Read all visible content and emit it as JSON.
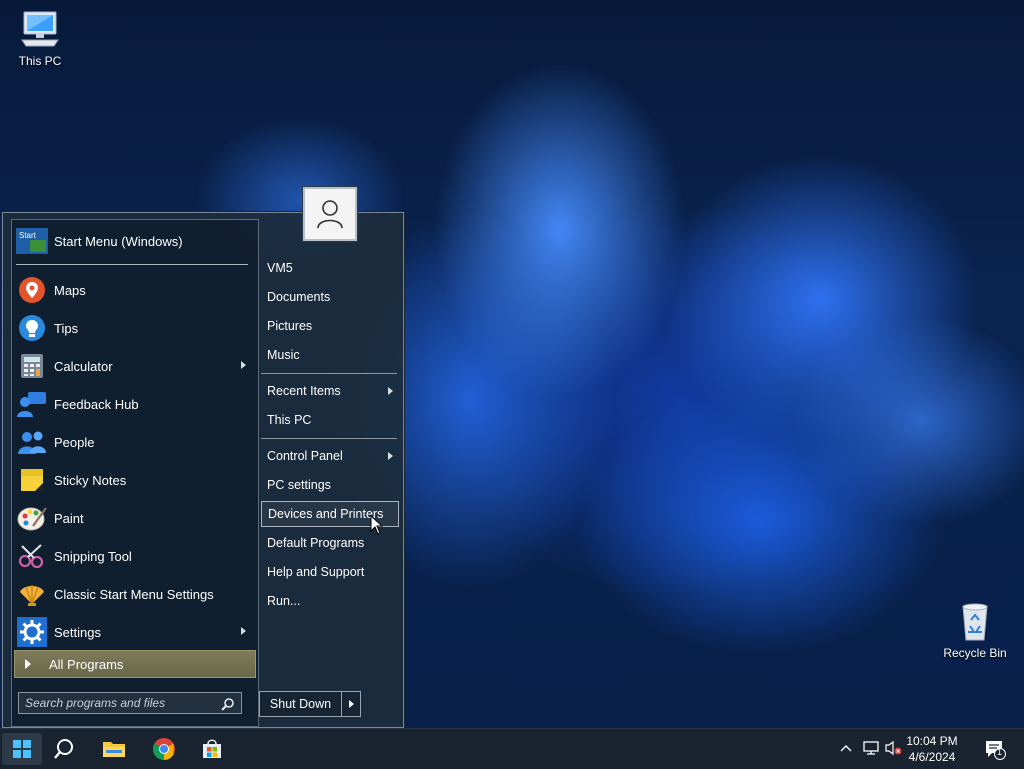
{
  "desktop": {
    "icons": [
      {
        "label": "This PC"
      },
      {
        "label": "Recycle Bin"
      }
    ]
  },
  "start_menu": {
    "header_item": {
      "label": "Start Menu (Windows)",
      "badge_text": "Start"
    },
    "apps": [
      {
        "label": "Maps",
        "icon": "maps-icon",
        "has_submenu": false
      },
      {
        "label": "Tips",
        "icon": "tips-icon",
        "has_submenu": false
      },
      {
        "label": "Calculator",
        "icon": "calculator-icon",
        "has_submenu": true
      },
      {
        "label": "Feedback Hub",
        "icon": "feedback-hub-icon",
        "has_submenu": false
      },
      {
        "label": "People",
        "icon": "people-icon",
        "has_submenu": false
      },
      {
        "label": "Sticky Notes",
        "icon": "sticky-notes-icon",
        "has_submenu": false
      },
      {
        "label": "Paint",
        "icon": "paint-icon",
        "has_submenu": false
      },
      {
        "label": "Snipping Tool",
        "icon": "snipping-tool-icon",
        "has_submenu": false
      },
      {
        "label": "Classic Start Menu Settings",
        "icon": "shell-icon",
        "has_submenu": false
      },
      {
        "label": "Settings",
        "icon": "gear-icon",
        "has_submenu": true
      }
    ],
    "all_programs": "All Programs",
    "search_placeholder": "Search programs and files",
    "right_items": [
      {
        "label": "VM5",
        "has_submenu": false
      },
      {
        "label": "Documents",
        "has_submenu": false
      },
      {
        "label": "Pictures",
        "has_submenu": false
      },
      {
        "label": "Music",
        "has_submenu": false
      },
      {
        "label": "Recent Items",
        "has_submenu": true
      },
      {
        "label": "This PC",
        "has_submenu": false
      },
      {
        "label": "Control Panel",
        "has_submenu": true
      },
      {
        "label": "PC settings",
        "has_submenu": false
      },
      {
        "label": "Devices and Printers",
        "has_submenu": false,
        "hovered": true
      },
      {
        "label": "Default Programs",
        "has_submenu": false
      },
      {
        "label": "Help and Support",
        "has_submenu": false
      },
      {
        "label": "Run...",
        "has_submenu": false
      }
    ],
    "shutdown": "Shut Down"
  },
  "taskbar": {
    "apps": [
      "windows-start-icon",
      "search-icon",
      "file-explorer-icon",
      "chrome-icon",
      "store-icon"
    ],
    "clock": {
      "time": "10:04 PM",
      "date": "4/6/2024"
    },
    "notification_count": "1"
  },
  "colors": {
    "menu_bg": "#1c2c3c",
    "all_programs_bg": "#7e7a5a",
    "taskbar_bg": "#1a2330"
  }
}
